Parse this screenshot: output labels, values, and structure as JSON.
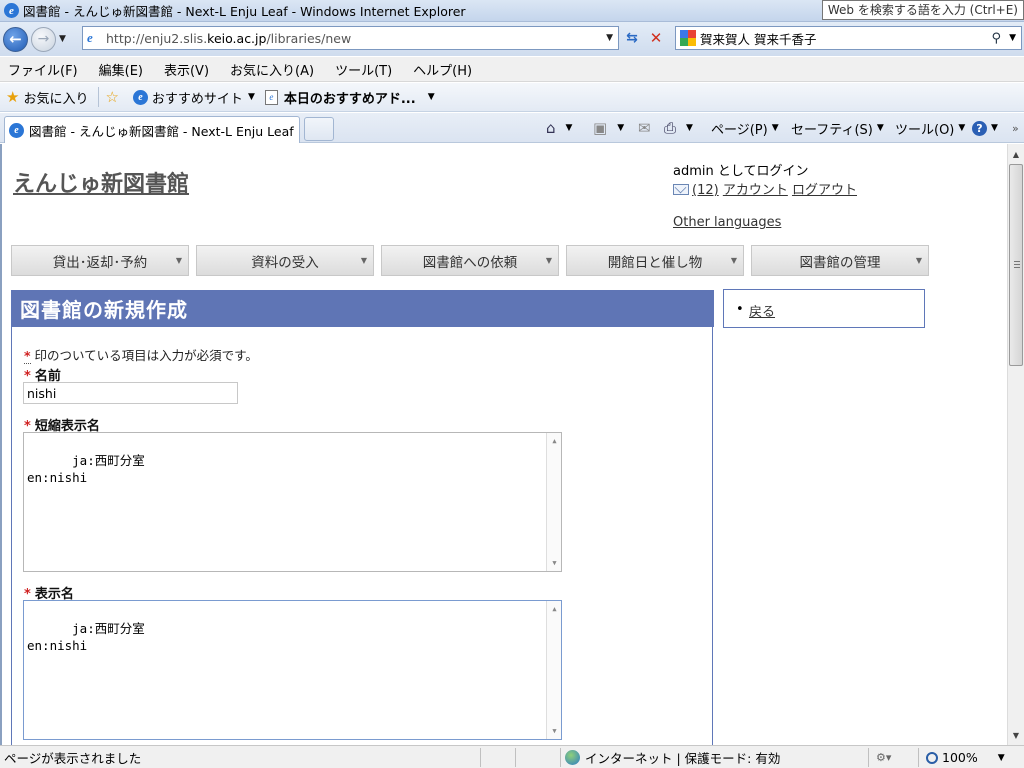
{
  "window": {
    "title": "図書館 - えんじゅ新図書館 - Next-L Enju Leaf - Windows Internet Explorer",
    "tooltip": "Web を検索する語を入力 (Ctrl+E)"
  },
  "address": {
    "url_prefix": "http://enju2.slis.",
    "url_host": "keio.ac.jp",
    "url_path": "/libraries/new"
  },
  "search": {
    "value": "賀来賀人 賀来千香子"
  },
  "menu": [
    "ファイル(F)",
    "編集(E)",
    "表示(V)",
    "お気に入り(A)",
    "ツール(T)",
    "ヘルプ(H)"
  ],
  "favorites": {
    "favorites_label": "お気に入り",
    "recommended_sites": "おすすめサイト",
    "todays_addon": "本日のおすすめアド..."
  },
  "tab": {
    "title": "図書館 - えんじゅ新図書館 - Next-L Enju Leaf"
  },
  "command_bar": {
    "page": "ページ(P)",
    "safety": "セーフティ(S)",
    "tools": "ツール(O)"
  },
  "site": {
    "title": "えんじゅ新図書館",
    "login_text": "admin としてログイン",
    "messages_count": "(12)",
    "account": "アカウント",
    "logout": "ログアウト",
    "other_languages": "Other languages"
  },
  "nav": [
    "貸出･返却･予約",
    "資料の受入",
    "図書館への依頼",
    "開館日と催し物",
    "図書館の管理"
  ],
  "form": {
    "heading": "図書館の新規作成",
    "required_mark": "*",
    "required_note": "印のついている項目は入力が必須です。",
    "name_label": "名前",
    "name_value": "nishi",
    "short_display_label": "短縮表示名",
    "short_display_value": "ja:西町分室\nen:nishi",
    "display_label": "表示名",
    "display_value": "ja:西町分室\nen:nishi"
  },
  "sidebar": {
    "back": "戻る"
  },
  "status": {
    "message": "ページが表示されました",
    "zone": "インターネット | 保護モード: 有効",
    "zoom": "100%"
  }
}
